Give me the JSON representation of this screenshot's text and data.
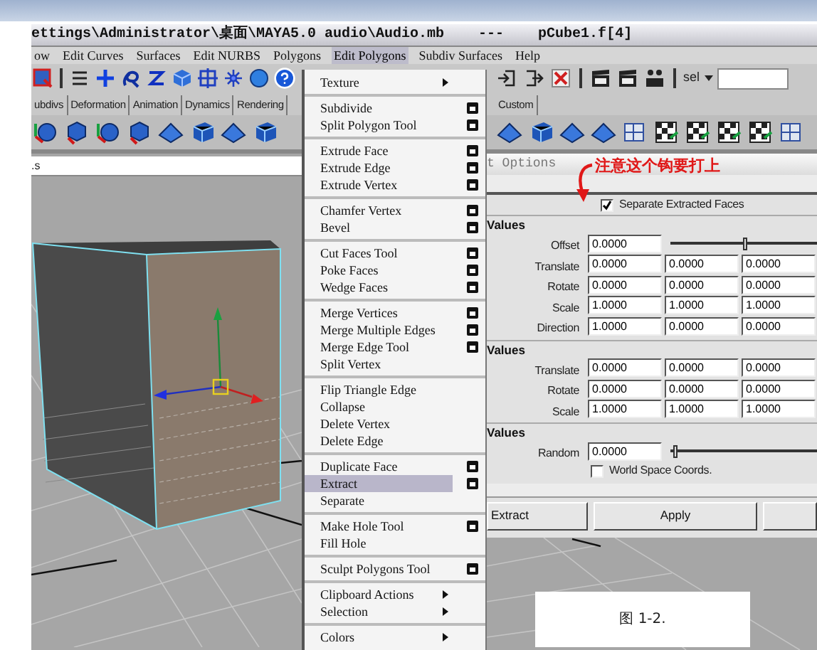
{
  "title_bar": {
    "title": "ettings\\Administrator\\桌面\\MAYA5.0 audio\\Audio.mb    ---    pCube1.f[4]"
  },
  "menu_bar": [
    {
      "label": "ow",
      "selected": false
    },
    {
      "label": "Edit Curves",
      "selected": false
    },
    {
      "label": "Surfaces",
      "selected": false
    },
    {
      "label": "Edit NURBS",
      "selected": false
    },
    {
      "label": "Polygons",
      "selected": false
    },
    {
      "label": "Edit Polygons",
      "selected": true
    },
    {
      "label": "Subdiv Surfaces",
      "selected": false
    },
    {
      "label": "Help",
      "selected": false
    }
  ],
  "toolbar": {
    "selection_label": "sel"
  },
  "shelf_tabs_left": [
    {
      "label": "ubdivs"
    },
    {
      "label": "Deformation"
    },
    {
      "label": "Animation"
    },
    {
      "label": "Dynamics"
    },
    {
      "label": "Rendering"
    }
  ],
  "shelf_tabs_right": [
    {
      "label": "Custom"
    }
  ],
  "viewport": {
    "panel_label": ".s"
  },
  "options": {
    "title": "t Options",
    "annotation": "注意这个钩要打上",
    "separate": {
      "label": "Separate Extracted Faces",
      "checked": true
    },
    "sections": [
      {
        "title": "Values",
        "rows": [
          {
            "kind": "slider",
            "label": "Offset",
            "values": [
              "0.0000"
            ],
            "level": 0.5
          },
          {
            "kind": "fields",
            "label": "Translate",
            "values": [
              "0.0000",
              "0.0000",
              "0.0000"
            ]
          },
          {
            "kind": "fields",
            "label": "Rotate",
            "values": [
              "0.0000",
              "0.0000",
              "0.0000"
            ]
          },
          {
            "kind": "fields",
            "label": "Scale",
            "values": [
              "1.0000",
              "1.0000",
              "1.0000"
            ]
          },
          {
            "kind": "fields",
            "label": "Direction",
            "values": [
              "1.0000",
              "0.0000",
              "0.0000"
            ]
          }
        ]
      },
      {
        "title": "Values",
        "rows": [
          {
            "kind": "fields",
            "label": "Translate",
            "values": [
              "0.0000",
              "0.0000",
              "0.0000"
            ]
          },
          {
            "kind": "fields",
            "label": "Rotate",
            "values": [
              "0.0000",
              "0.0000",
              "0.0000"
            ]
          },
          {
            "kind": "fields",
            "label": "Scale",
            "values": [
              "1.0000",
              "1.0000",
              "1.0000"
            ]
          }
        ]
      },
      {
        "title": "Values",
        "rows": [
          {
            "kind": "slider",
            "label": "Random",
            "values": [
              "0.0000"
            ],
            "level": 0.03
          },
          {
            "kind": "checkbox",
            "label": "World Space Coords.",
            "checked": false
          }
        ]
      }
    ],
    "buttons": [
      "Extract",
      "Apply"
    ]
  },
  "caption": "图 1-2.",
  "menu": {
    "groups": [
      [
        {
          "label": "Texture",
          "selected": false,
          "option_box": false,
          "submenu": true
        }
      ],
      [
        {
          "label": "Subdivide",
          "selected": false,
          "option_box": true,
          "submenu": false
        },
        {
          "label": "Split Polygon Tool",
          "selected": false,
          "option_box": true,
          "submenu": false
        }
      ],
      [
        {
          "label": "Extrude Face",
          "selected": false,
          "option_box": true,
          "submenu": false
        },
        {
          "label": "Extrude Edge",
          "selected": false,
          "option_box": true,
          "submenu": false
        },
        {
          "label": "Extrude Vertex",
          "selected": false,
          "option_box": true,
          "submenu": false
        }
      ],
      [
        {
          "label": "Chamfer Vertex",
          "selected": false,
          "option_box": true,
          "submenu": false
        },
        {
          "label": "Bevel",
          "selected": false,
          "option_box": true,
          "submenu": false
        }
      ],
      [
        {
          "label": "Cut Faces Tool",
          "selected": false,
          "option_box": true,
          "submenu": false
        },
        {
          "label": "Poke Faces",
          "selected": false,
          "option_box": true,
          "submenu": false
        },
        {
          "label": "Wedge Faces",
          "selected": false,
          "option_box": true,
          "submenu": false
        }
      ],
      [
        {
          "label": "Merge Vertices",
          "selected": false,
          "option_box": true,
          "submenu": false
        },
        {
          "label": "Merge Multiple Edges",
          "selected": false,
          "option_box": true,
          "submenu": false
        },
        {
          "label": "Merge Edge Tool",
          "selected": false,
          "option_box": true,
          "submenu": false
        },
        {
          "label": "Split Vertex",
          "selected": false,
          "option_box": false,
          "submenu": false
        }
      ],
      [
        {
          "label": "Flip Triangle Edge",
          "selected": false,
          "option_box": false,
          "submenu": false
        },
        {
          "label": "Collapse",
          "selected": false,
          "option_box": false,
          "submenu": false
        },
        {
          "label": "Delete Vertex",
          "selected": false,
          "option_box": false,
          "submenu": false
        },
        {
          "label": "Delete Edge",
          "selected": false,
          "option_box": false,
          "submenu": false
        }
      ],
      [
        {
          "label": "Duplicate Face",
          "selected": false,
          "option_box": true,
          "submenu": false
        },
        {
          "label": "Extract",
          "selected": true,
          "option_box": true,
          "submenu": false
        },
        {
          "label": "Separate",
          "selected": false,
          "option_box": false,
          "submenu": false
        }
      ],
      [
        {
          "label": "Make Hole Tool",
          "selected": false,
          "option_box": true,
          "submenu": false
        },
        {
          "label": "Fill Hole",
          "selected": false,
          "option_box": false,
          "submenu": false
        }
      ],
      [
        {
          "label": "Sculpt Polygons Tool",
          "selected": false,
          "option_box": true,
          "submenu": false
        }
      ],
      [
        {
          "label": "Clipboard Actions",
          "selected": false,
          "option_box": false,
          "submenu": true
        },
        {
          "label": "Selection",
          "selected": false,
          "option_box": false,
          "submenu": true
        }
      ],
      [
        {
          "label": "Colors",
          "selected": false,
          "option_box": false,
          "submenu": true
        }
      ]
    ]
  }
}
